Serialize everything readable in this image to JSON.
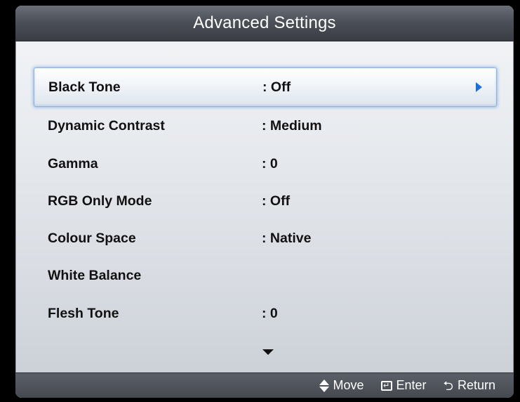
{
  "title": "Advanced Settings",
  "menu_items": [
    {
      "label": "Black Tone",
      "value": ": Off",
      "selected": true
    },
    {
      "label": "Dynamic Contrast",
      "value": ": Medium",
      "selected": false
    },
    {
      "label": "Gamma",
      "value": ": 0",
      "selected": false
    },
    {
      "label": "RGB Only Mode",
      "value": ": Off",
      "selected": false
    },
    {
      "label": "Colour Space",
      "value": ": Native",
      "selected": false
    },
    {
      "label": "White Balance",
      "value": "",
      "selected": false
    },
    {
      "label": "Flesh Tone",
      "value": ": 0",
      "selected": false
    }
  ],
  "footer": {
    "move_label": "Move",
    "enter_label": "Enter",
    "return_label": "Return"
  },
  "icons": {
    "selected_arrow": "arrow-right-icon",
    "scroll": "scroll-down-icon",
    "move": "up-down-arrow-icon",
    "enter": "enter-icon",
    "return": "return-icon"
  },
  "colors": {
    "accent": "#1e6fd6",
    "title_bar": "#4c5058",
    "panel": "#e7eaee"
  }
}
